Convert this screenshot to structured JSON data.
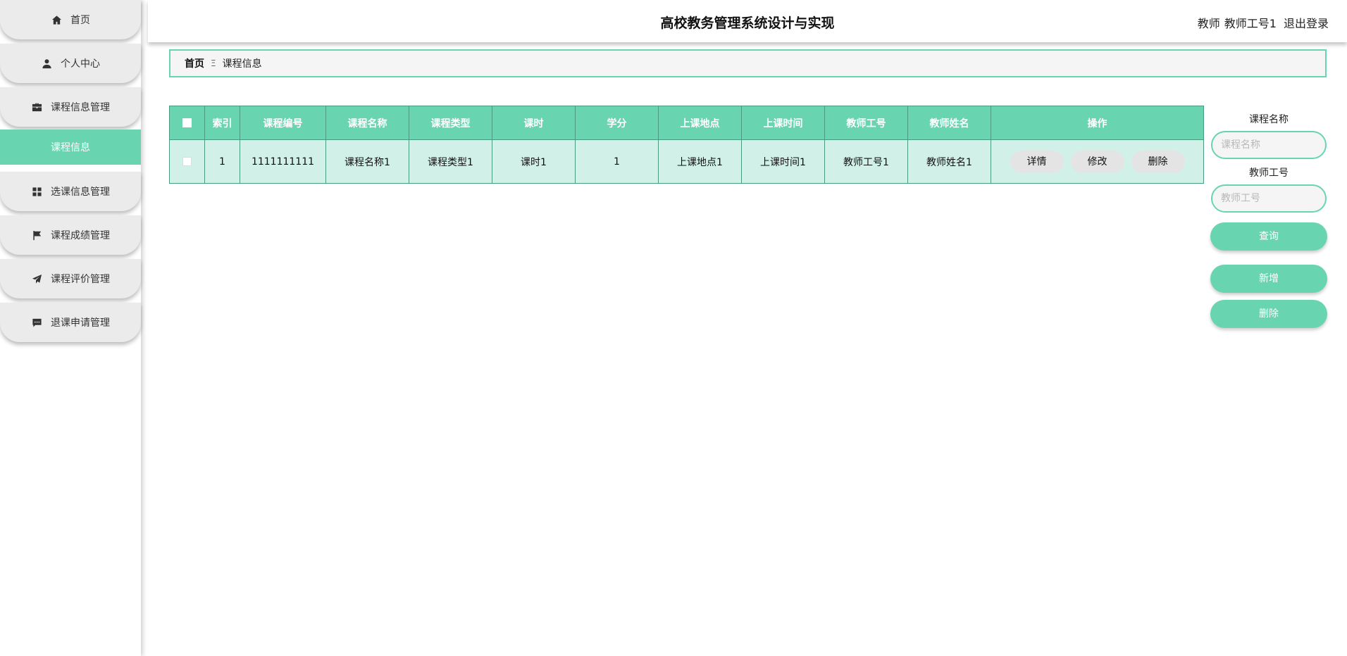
{
  "header": {
    "title": "高校教务管理系统设计与实现",
    "role": "教师",
    "user": "教师工号1",
    "logout": "退出登录"
  },
  "sidebar": {
    "items": [
      {
        "label": "首页",
        "icon": "home-icon"
      },
      {
        "label": "个人中心",
        "icon": "person-icon"
      },
      {
        "label": "课程信息管理",
        "icon": "briefcase-icon"
      },
      {
        "label": "选课信息管理",
        "icon": "grid-icon"
      },
      {
        "label": "课程成绩管理",
        "icon": "flag-icon"
      },
      {
        "label": "课程评价管理",
        "icon": "send-icon"
      },
      {
        "label": "退课申请管理",
        "icon": "chat-icon"
      }
    ],
    "active_sub": "课程信息"
  },
  "breadcrumb": {
    "home": "首页",
    "separator": "Ξ",
    "current": "课程信息"
  },
  "table": {
    "headers": [
      "索引",
      "课程编号",
      "课程名称",
      "课程类型",
      "课时",
      "学分",
      "上课地点",
      "上课时间",
      "教师工号",
      "教师姓名",
      "操作"
    ],
    "rows": [
      {
        "cells": [
          "1",
          "1111111111",
          "课程名称1",
          "课程类型1",
          "课时1",
          "1",
          "上课地点1",
          "上课时间1",
          "教师工号1",
          "教师姓名1"
        ],
        "actions": [
          "详情",
          "修改",
          "删除"
        ]
      }
    ]
  },
  "search": {
    "fields": [
      {
        "label": "课程名称",
        "placeholder": "课程名称"
      },
      {
        "label": "教师工号",
        "placeholder": "教师工号"
      }
    ],
    "query_button": "查询",
    "add_button": "新增",
    "delete_button": "删除"
  },
  "colors": {
    "accent": "#68d5b0",
    "row_background": "#d1f1e8",
    "nav_background": "#ebebeb"
  }
}
